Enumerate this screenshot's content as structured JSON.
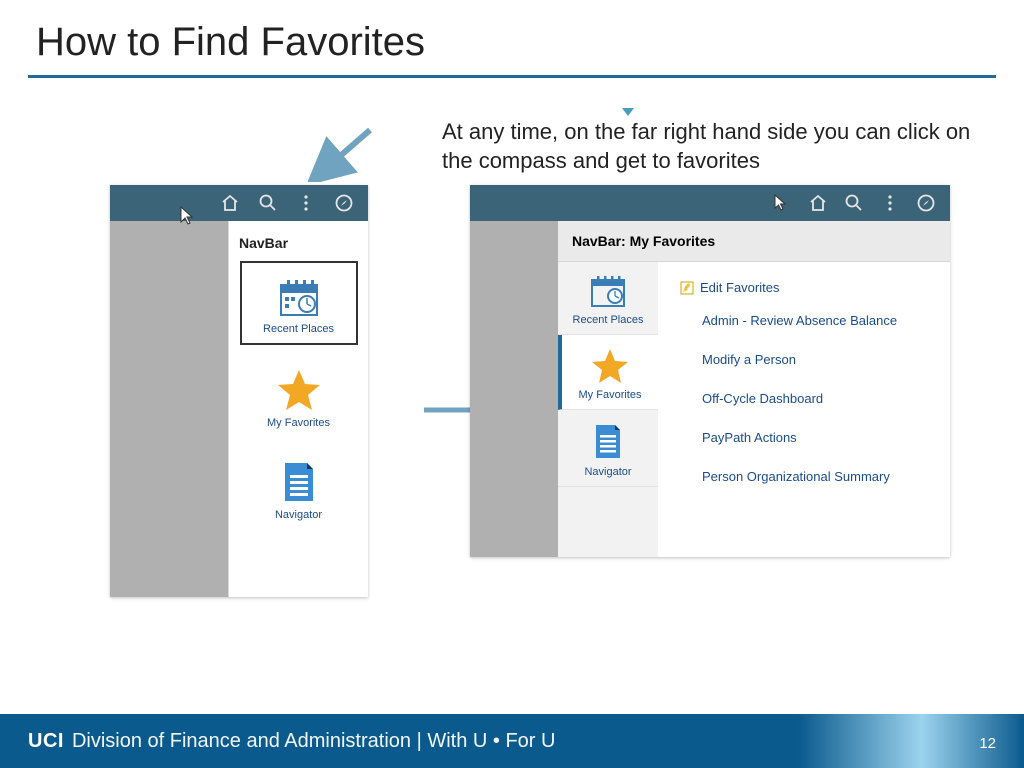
{
  "title": "How to Find Favorites",
  "caption": "At any time, on the far right hand side you can click on the compass and get to favorites",
  "navbar": {
    "title": "NavBar",
    "items": [
      {
        "label": "Recent Places"
      },
      {
        "label": "My Favorites"
      },
      {
        "label": "Navigator"
      }
    ]
  },
  "favorites_panel": {
    "title": "NavBar: My Favorites",
    "nav_items": [
      {
        "label": "Recent Places"
      },
      {
        "label": "My Favorites"
      },
      {
        "label": "Navigator"
      }
    ],
    "edit_label": "Edit Favorites",
    "links": [
      "Admin - Review Absence Balance",
      "Modify a Person",
      "Off-Cycle Dashboard",
      "PayPath Actions",
      "Person Organizational Summary"
    ]
  },
  "footer": {
    "brand": "UCI",
    "text": "Division of Finance and Administration | With U • For U",
    "page": "12"
  }
}
